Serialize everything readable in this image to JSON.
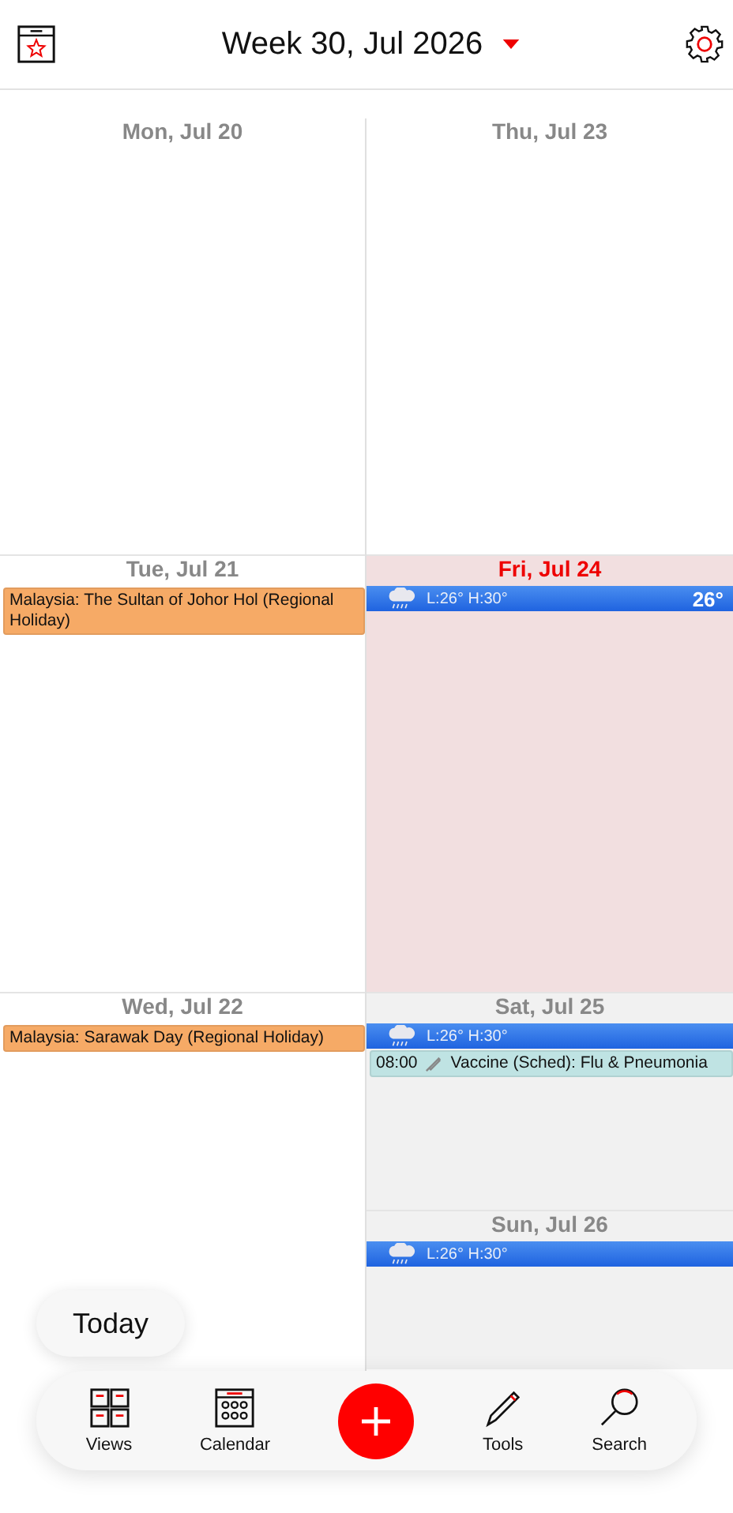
{
  "header": {
    "title": "Week 30, Jul 2026"
  },
  "columns": [
    {
      "days": [
        {
          "label": "Mon, Jul 20",
          "kind": "weekday",
          "today": false
        },
        {
          "label": "Tue, Jul 21",
          "kind": "weekday",
          "today": false,
          "events": [
            {
              "title": "Malaysia: The Sultan of Johor Hol (Regional Holiday)",
              "color": "#f6aa66",
              "icon": false
            }
          ]
        },
        {
          "label": "Wed, Jul 22",
          "kind": "weekday",
          "today": false,
          "events": [
            {
              "title": "Malaysia: Sarawak Day (Regional Holiday)",
              "color": "#f6aa66",
              "icon": false
            }
          ]
        }
      ]
    },
    {
      "days": [
        {
          "label": "Thu, Jul 23",
          "kind": "weekday",
          "today": false
        },
        {
          "label": "Fri, Jul 24",
          "kind": "weekday",
          "today": true,
          "weather": {
            "range": "L:26° H:30°",
            "current": "26°"
          }
        },
        {
          "label": "Sat, Jul 25",
          "kind": "weekend",
          "today": false,
          "weather": {
            "range": "L:26° H:30°"
          },
          "events": [
            {
              "time": "08:00",
              "title": "Vaccine (Sched): Flu & Pneumonia",
              "color": "#bfe3e3",
              "icon": true
            }
          ]
        },
        {
          "label": "Sun, Jul 26",
          "kind": "weekend",
          "today": false,
          "weather": {
            "range": "L:26° H:30°"
          }
        }
      ]
    }
  ],
  "today_button": "Today",
  "nav": [
    {
      "kind": "views",
      "label": "Views"
    },
    {
      "kind": "calendar",
      "label": "Calendar"
    },
    {
      "kind": "add"
    },
    {
      "kind": "tools",
      "label": "Tools"
    },
    {
      "kind": "search",
      "label": "Search"
    }
  ]
}
